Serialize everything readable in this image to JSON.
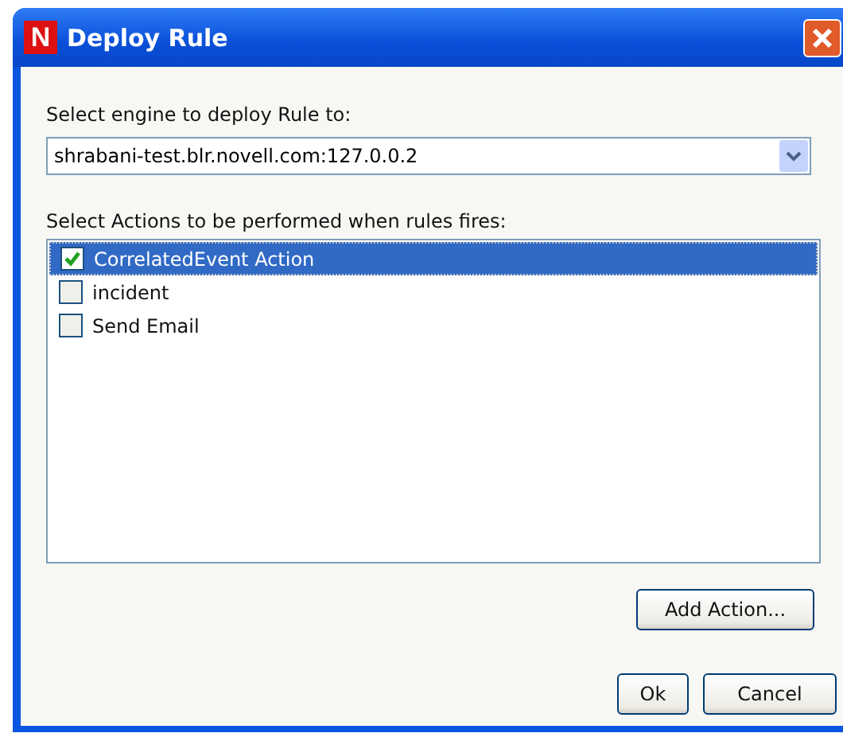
{
  "window": {
    "logo": "N",
    "title": "Deploy Rule"
  },
  "engine": {
    "label": "Select engine to deploy Rule to:",
    "value": "shrabani-test.blr.novell.com:127.0.0.2"
  },
  "actions": {
    "label": "Select Actions to be performed when rules fires:",
    "items": [
      {
        "label": "CorrelatedEvent Action",
        "checked": true,
        "selected": true
      },
      {
        "label": "incident",
        "checked": false,
        "selected": false
      },
      {
        "label": "Send Email",
        "checked": false,
        "selected": false
      }
    ]
  },
  "add_button": "Add Action...",
  "buttons": [
    "Ok",
    "Cancel"
  ]
}
